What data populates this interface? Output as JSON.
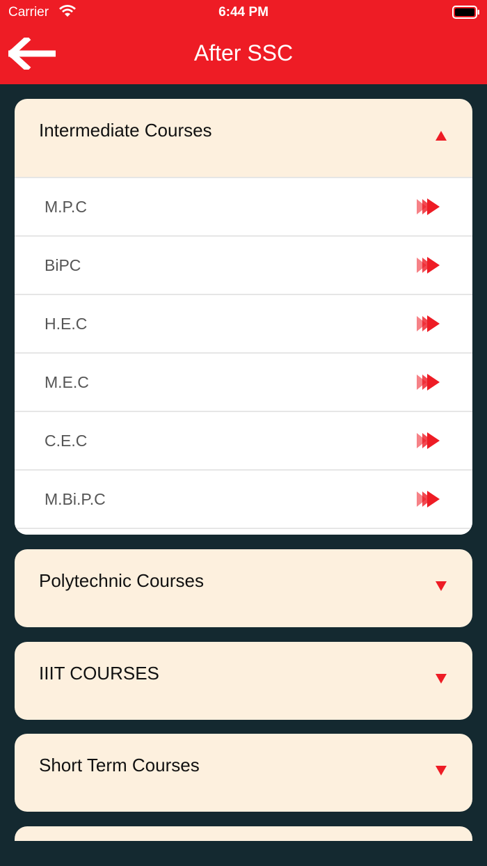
{
  "status_bar": {
    "carrier": "Carrier",
    "time": "6:44 PM"
  },
  "header": {
    "title": "After SSC",
    "background_color": "#ee1c25",
    "back_icon": "arrow-left-icon"
  },
  "colors": {
    "page_background": "#142930",
    "card_background": "#fdf0de",
    "accent": "#ee1c25"
  },
  "sections": [
    {
      "title": "Intermediate Courses",
      "expanded": true,
      "items": [
        {
          "label": "M.P.C"
        },
        {
          "label": "BiPC"
        },
        {
          "label": "H.E.C"
        },
        {
          "label": "M.E.C"
        },
        {
          "label": "C.E.C"
        },
        {
          "label": "M.Bi.P.C"
        }
      ]
    },
    {
      "title": "Polytechnic Courses",
      "expanded": false
    },
    {
      "title": "IIIT COURSES",
      "expanded": false
    },
    {
      "title": "Short Term Courses",
      "expanded": false
    }
  ]
}
